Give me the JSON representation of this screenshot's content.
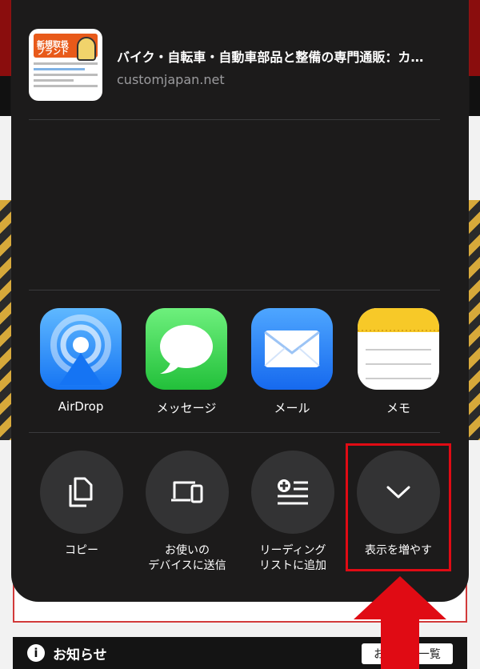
{
  "background": {
    "notice_icon": "i",
    "notice_title": "お知らせ",
    "notice_button": "お知らせ一覧"
  },
  "preview": {
    "thumbnail_text_1": "新規取扱",
    "thumbnail_text_2": "ブランド",
    "title": "バイク・自転車・自動車部品と整備の専門通販：カ…",
    "url": "customjapan.net"
  },
  "apps": [
    {
      "label": "AirDrop",
      "icon": "airdrop-icon"
    },
    {
      "label": "メッセージ",
      "icon": "messages-icon"
    },
    {
      "label": "メール",
      "icon": "mail-icon"
    },
    {
      "label": "メモ",
      "icon": "notes-icon"
    }
  ],
  "actions": [
    {
      "label": "コピー",
      "icon": "copy-icon"
    },
    {
      "label": "お使いの\nデバイスに送信",
      "icon": "send-to-device-icon"
    },
    {
      "label": "リーディング\nリストに追加",
      "icon": "reading-list-add-icon"
    },
    {
      "label": "表示を増やす",
      "icon": "chevron-down-icon"
    }
  ],
  "colors": {
    "sheet": "#1c1b1b",
    "action_circle": "#333334",
    "highlight": "#e00b14"
  }
}
